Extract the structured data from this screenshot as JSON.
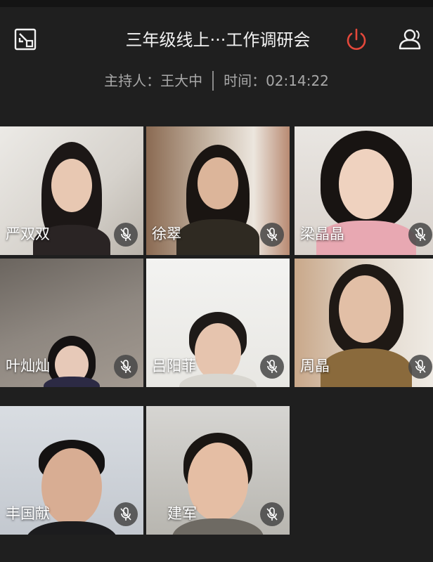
{
  "header": {
    "title": "三年级线上···工作调研会",
    "host_label": "主持人：",
    "host_name": "王大中",
    "time_label": "时间：",
    "time_value": "02:14:22"
  },
  "icons": {
    "minimize": "minimize-window-icon",
    "end_meeting": "power-icon",
    "participants": "participants-icon",
    "muted": "mic-muted-icon"
  },
  "colors": {
    "background": "#1f1f1f",
    "end_meeting": "#e5483b",
    "text_primary": "#f2f2f2",
    "text_secondary": "#a8a8a8"
  },
  "participants": [
    {
      "name": "严双双",
      "muted": true
    },
    {
      "name": "徐翠",
      "muted": true
    },
    {
      "name": "梁晶晶",
      "muted": true
    },
    {
      "name": "叶灿灿",
      "muted": true
    },
    {
      "name": "吕阳菲",
      "muted": true
    },
    {
      "name": "周晶",
      "muted": true
    },
    {
      "name": "丰国献",
      "muted": true
    },
    {
      "name": "建军",
      "muted": true
    }
  ]
}
